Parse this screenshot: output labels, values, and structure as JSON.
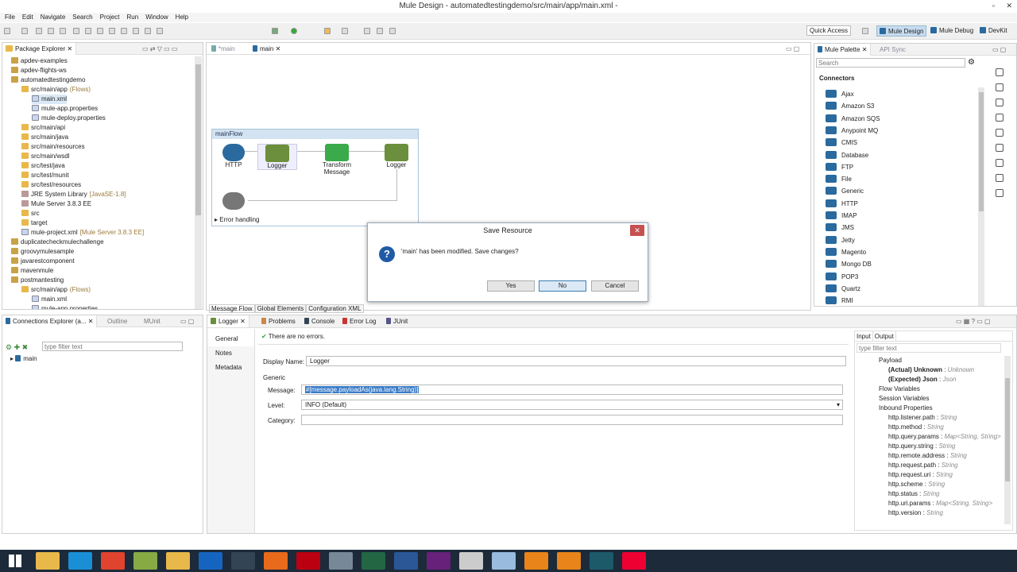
{
  "window": {
    "title": "Mule Design - automatedtestingdemo/src/main/app/main.xml -",
    "controls": [
      "▫",
      "✕"
    ]
  },
  "menu": [
    "File",
    "Edit",
    "Navigate",
    "Search",
    "Project",
    "Run",
    "Window",
    "Help"
  ],
  "toolbar": {
    "quick_access": "Quick Access",
    "perspectives": [
      "Mule Design",
      "Mule Debug",
      "DevKit"
    ]
  },
  "package_explorer": {
    "title": "Package Explorer",
    "items": [
      {
        "label": "apdev-examples",
        "indent": 1,
        "icon": "project"
      },
      {
        "label": "apdev-flights-ws",
        "indent": 1,
        "icon": "project"
      },
      {
        "label": "automatedtestingdemo",
        "indent": 1,
        "icon": "project"
      },
      {
        "label": "src/main/app",
        "deco": "(Flows)",
        "indent": 2,
        "icon": "folder"
      },
      {
        "label": "main.xml",
        "indent": 3,
        "icon": "file"
      },
      {
        "label": "mule-app.properties",
        "indent": 3,
        "icon": "file"
      },
      {
        "label": "mule-deploy.properties",
        "indent": 3,
        "icon": "file"
      },
      {
        "label": "src/main/api",
        "indent": 2,
        "icon": "folder"
      },
      {
        "label": "src/main/java",
        "indent": 2,
        "icon": "folder"
      },
      {
        "label": "src/main/resources",
        "indent": 2,
        "icon": "folder"
      },
      {
        "label": "src/main/wsdl",
        "indent": 2,
        "icon": "folder"
      },
      {
        "label": "src/test/java",
        "indent": 2,
        "icon": "folder"
      },
      {
        "label": "src/test/munit",
        "indent": 2,
        "icon": "folder"
      },
      {
        "label": "src/test/resources",
        "indent": 2,
        "icon": "folder"
      },
      {
        "label": "JRE System Library",
        "deco": "[JavaSE-1.8]",
        "indent": 2,
        "icon": "lib"
      },
      {
        "label": "Mule Server 3.8.3 EE",
        "indent": 2,
        "icon": "lib"
      },
      {
        "label": "src",
        "indent": 2,
        "icon": "folder"
      },
      {
        "label": "target",
        "indent": 2,
        "icon": "folder"
      },
      {
        "label": "mule-project.xml",
        "deco": "[Mule Server 3.8.3 EE]",
        "indent": 2,
        "icon": "file"
      },
      {
        "label": "duplicatecheckmulechallenge",
        "indent": 1,
        "icon": "project"
      },
      {
        "label": "groovymulesample",
        "indent": 1,
        "icon": "project"
      },
      {
        "label": "javarestcomponent",
        "indent": 1,
        "icon": "project"
      },
      {
        "label": "mavenmule",
        "indent": 1,
        "icon": "project"
      },
      {
        "label": "postmantesting",
        "indent": 1,
        "icon": "project"
      },
      {
        "label": "src/main/app",
        "deco": "(Flows)",
        "indent": 2,
        "icon": "folder"
      },
      {
        "label": "main.xml",
        "indent": 3,
        "icon": "file"
      },
      {
        "label": "mule-app.properties",
        "indent": 3,
        "icon": "file"
      }
    ]
  },
  "editor": {
    "tabs": [
      "*main",
      "main"
    ],
    "flow_name": "mainFlow",
    "nodes": [
      {
        "label": "HTTP",
        "color": "#2a6a9e"
      },
      {
        "label": "Logger",
        "color": "#6b8f3c"
      },
      {
        "label": "Transform Message",
        "color": "#3aaa4a"
      },
      {
        "label": "Logger",
        "color": "#6b8f3c"
      }
    ],
    "error_node": "HTTP",
    "error_handling": "Error handling",
    "bottom_tabs": [
      "Message Flow",
      "Global Elements",
      "Configuration XML"
    ]
  },
  "dialog": {
    "title": "Save Resource",
    "message": "'main' has been modified. Save changes?",
    "buttons": [
      "Yes",
      "No",
      "Cancel"
    ]
  },
  "palette": {
    "title": "Mule Palette",
    "tab2": "API Sync",
    "search_placeholder": "Search",
    "section": "Connectors",
    "items": [
      "Ajax",
      "Amazon S3",
      "Amazon SQS",
      "Anypoint MQ",
      "CMIS",
      "Database",
      "FTP",
      "File",
      "Generic",
      "HTTP",
      "IMAP",
      "JMS",
      "Jetty",
      "Magento",
      "Mongo DB",
      "POP3",
      "Quartz",
      "RMI"
    ]
  },
  "connections": {
    "tabs": [
      "Connections Explorer (a...",
      "Outline",
      "MUnit"
    ],
    "filter_placeholder": "type filter text",
    "items": [
      "main"
    ]
  },
  "properties": {
    "tabs": [
      "Logger",
      "Problems",
      "Console",
      "Error Log",
      "JUnit"
    ],
    "status": "There are no errors.",
    "side_tabs": [
      "General",
      "Notes",
      "Metadata"
    ],
    "display_name_label": "Display Name:",
    "display_name": "Logger",
    "group": "Generic",
    "message_label": "Message:",
    "message": "#[message.payloadAs(java.lang.String)]",
    "level_label": "Level:",
    "level": "INFO (Default)",
    "category_label": "Category:",
    "category": ""
  },
  "metadata": {
    "tabs": [
      "Input",
      "Output"
    ],
    "filter_placeholder": "type filter text",
    "tree": [
      {
        "name": "Payload",
        "type": "",
        "indent": 1
      },
      {
        "name": "(Actual) Unknown",
        "type": "Unknown",
        "indent": 2,
        "bold": true
      },
      {
        "name": "(Expected) Json",
        "type": "Json",
        "indent": 2,
        "bold": true
      },
      {
        "name": "Flow Variables",
        "type": "",
        "indent": 1
      },
      {
        "name": "Session Variables",
        "type": "",
        "indent": 1
      },
      {
        "name": "Inbound Properties",
        "type": "",
        "indent": 1
      },
      {
        "name": "http.listener.path",
        "type": "String",
        "indent": 2
      },
      {
        "name": "http.method",
        "type": "String",
        "indent": 2
      },
      {
        "name": "http.query.params",
        "type": "Map<String, String>",
        "indent": 2
      },
      {
        "name": "http.query.string",
        "type": "String",
        "indent": 2
      },
      {
        "name": "http.remote.address",
        "type": "String",
        "indent": 2
      },
      {
        "name": "http.request.path",
        "type": "String",
        "indent": 2
      },
      {
        "name": "http.request.uri",
        "type": "String",
        "indent": 2
      },
      {
        "name": "http.scheme",
        "type": "String",
        "indent": 2
      },
      {
        "name": "http.status",
        "type": "String",
        "indent": 2
      },
      {
        "name": "http.uri.params",
        "type": "Map<String, String>",
        "indent": 2
      },
      {
        "name": "http.version",
        "type": "String",
        "indent": 2
      }
    ]
  },
  "taskbar": {
    "apps": [
      "start",
      "file-explorer",
      "skype",
      "chrome",
      "app4",
      "file-manager",
      "outlook",
      "app7",
      "firefox",
      "acrobat",
      "app10",
      "terminal",
      "word",
      "visual-studio",
      "notepad",
      "app15",
      "app16",
      "app17",
      "anypoint-studio",
      "app19"
    ]
  }
}
